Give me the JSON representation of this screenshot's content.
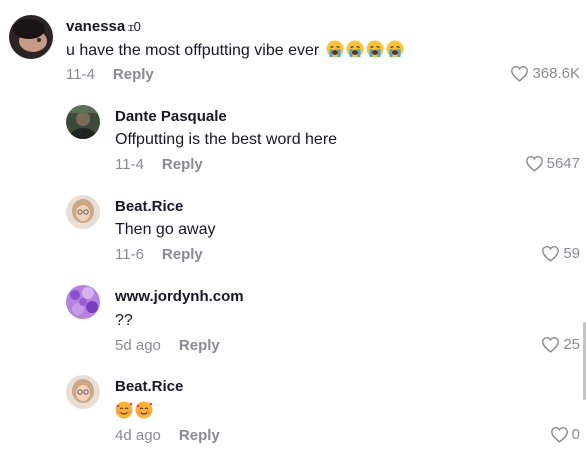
{
  "comments": [
    {
      "username": "vanessa",
      "extra": "ꮖ0",
      "text": "u have the most offputting vibe ever",
      "text_emojis": [
        "loudly-crying-face",
        "loudly-crying-face",
        "loudly-crying-face",
        "loudly-crying-face"
      ],
      "date": "11-4",
      "reply": "Reply",
      "likes": "368.6K"
    },
    {
      "username": "Dante Pasquale",
      "text": "Offputting is the best word here",
      "date": "11-4",
      "reply": "Reply",
      "likes": "5647"
    },
    {
      "username": "Beat.Rice",
      "text": "Then go away",
      "date": "11-6",
      "reply": "Reply",
      "likes": "59"
    },
    {
      "username": "www.jordynh.com",
      "text": "??",
      "date": "5d ago",
      "reply": "Reply",
      "likes": "25"
    },
    {
      "username": "Beat.Rice",
      "text": "",
      "text_emojis": [
        "smiling-face-with-hearts",
        "smiling-face-with-hearts"
      ],
      "date": "4d ago",
      "reply": "Reply",
      "likes": "0"
    }
  ],
  "colors": {
    "text": "#161823",
    "muted": "#8a8b91"
  },
  "icons": {
    "like": "heart-outline-icon",
    "crying": "loudly-crying-face-emoji",
    "hearts": "smiling-face-with-hearts-emoji"
  }
}
